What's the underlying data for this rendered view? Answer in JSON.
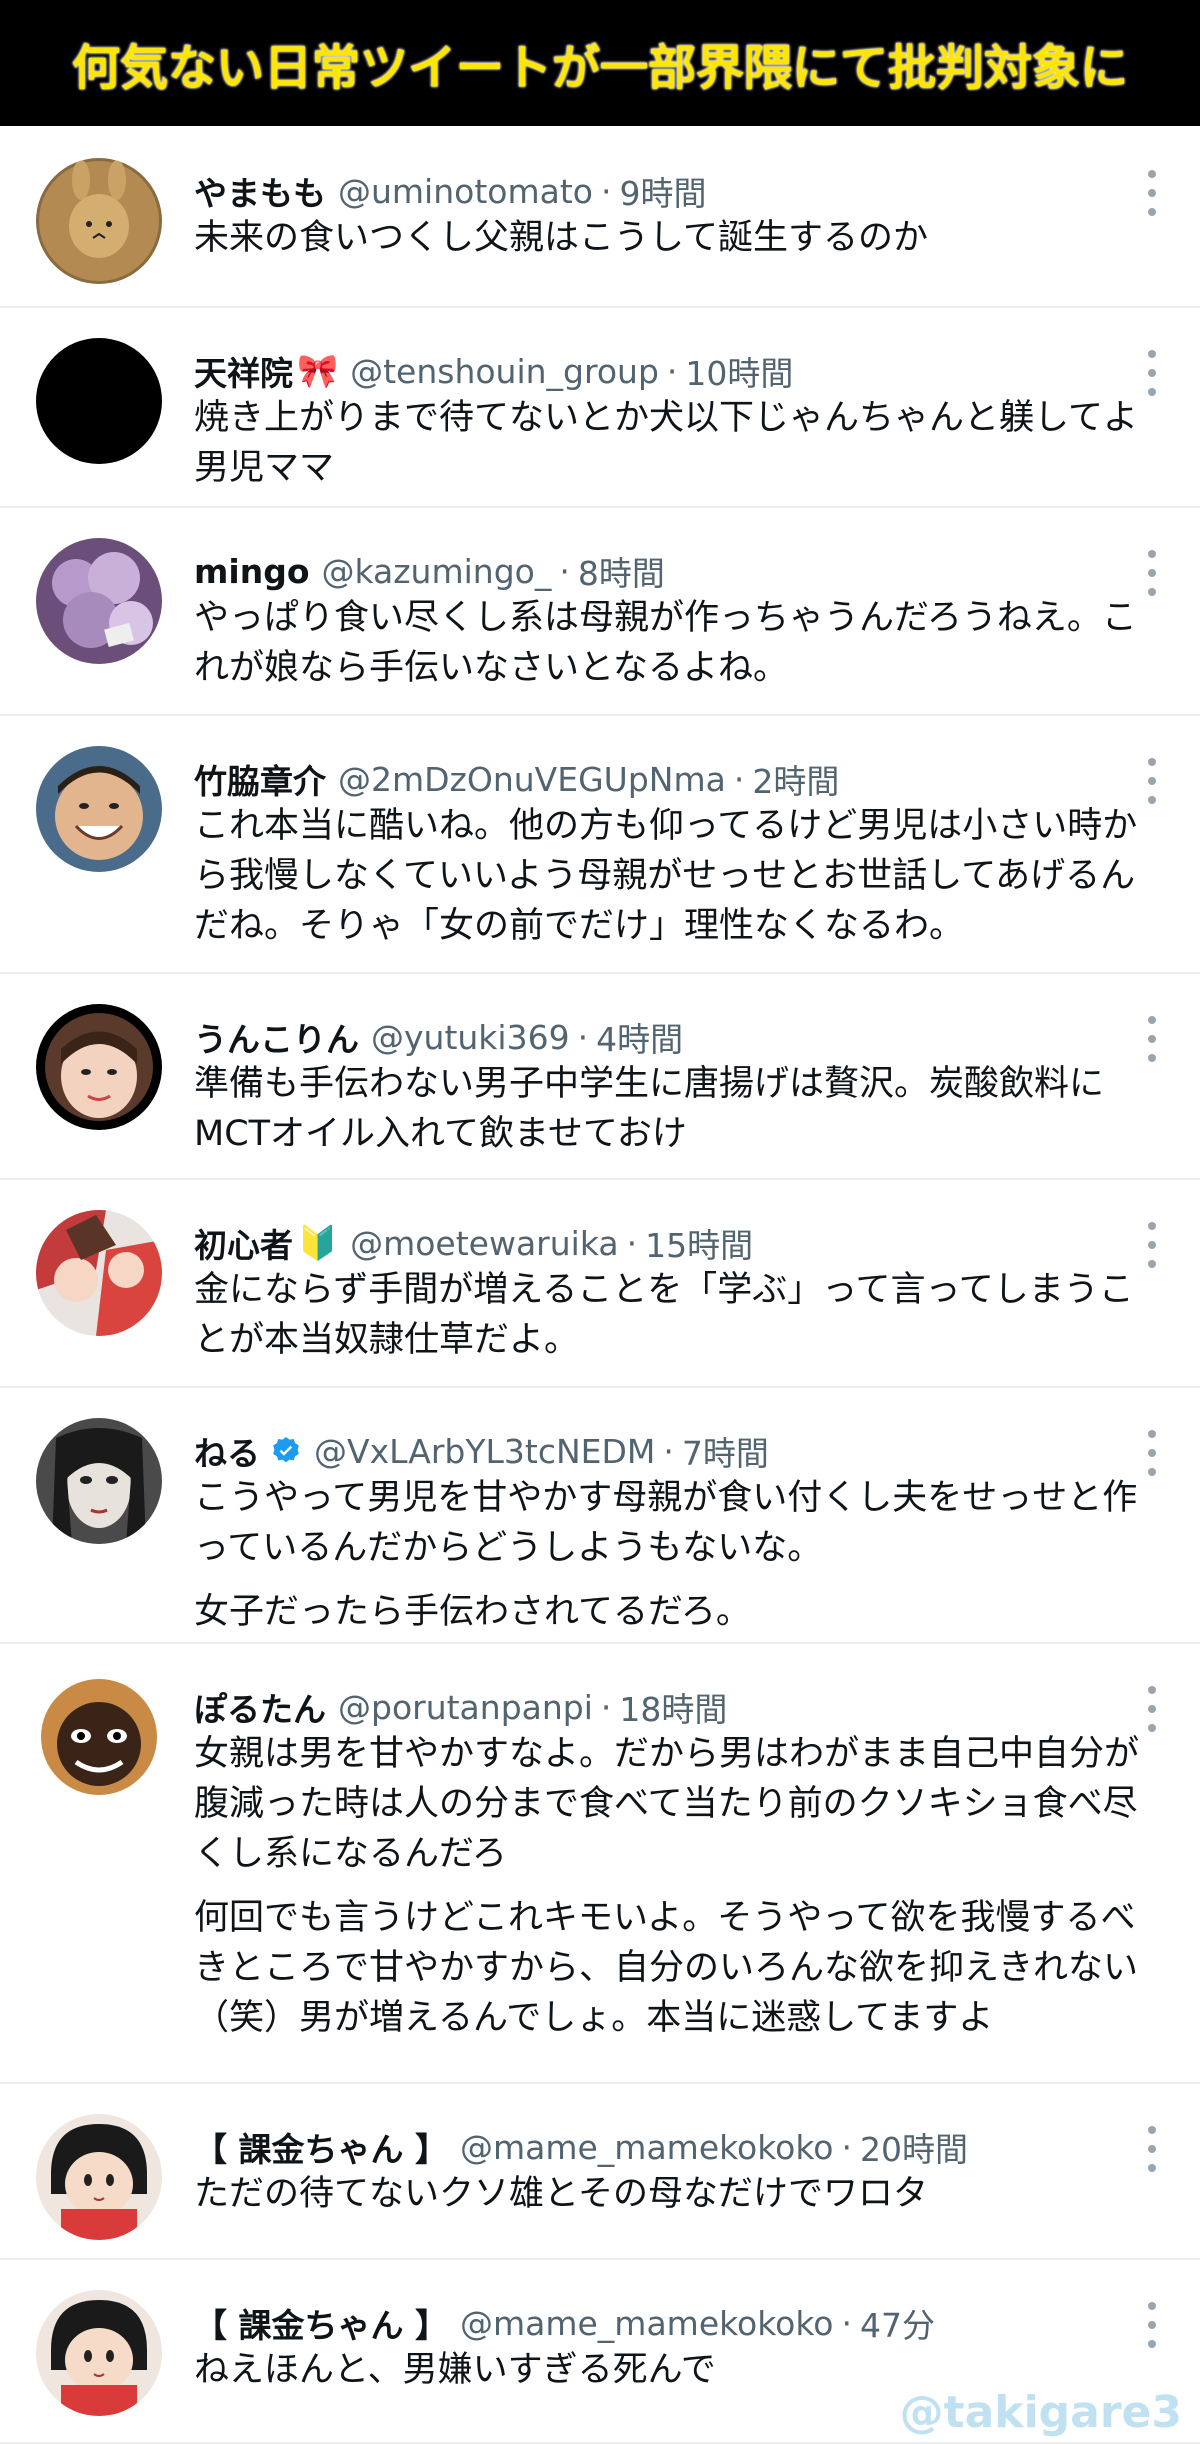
{
  "banner": {
    "title": "何気ない日常ツイートが一部界隈にて批判対象に"
  },
  "tweets": [
    {
      "name": "やまもも",
      "handle": "@uminotomato",
      "time": "9時間",
      "badge": "",
      "verified": false,
      "lines": [
        "未来の食いつくし父親はこうして誕生するのか"
      ]
    },
    {
      "name": "天祥院",
      "handle": "@tenshouin_group",
      "time": "10時間",
      "badge": "🎀",
      "verified": false,
      "lines": [
        "焼き上がりまで待てないとか犬以下じゃんちゃんと躾してよ男児ママ"
      ]
    },
    {
      "name": "mingo",
      "handle": "@kazumingo_",
      "time": "8時間",
      "badge": "",
      "verified": false,
      "lines": [
        "やっぱり食い尽くし系は母親が作っちゃうんだろうねえ。これが娘なら手伝いなさいとなるよね。"
      ]
    },
    {
      "name": "竹脇章介",
      "handle": "@2mDzOnuVEGUpNma",
      "time": "2時間",
      "badge": "",
      "verified": false,
      "lines": [
        "これ本当に酷いね。他の方も仰ってるけど男児は小さい時から我慢しなくていいよう母親がせっせとお世話してあげるんだね。そりゃ「女の前でだけ」理性なくなるわ。"
      ]
    },
    {
      "name": "うんこりん",
      "handle": "@yutuki369",
      "time": "4時間",
      "badge": "",
      "verified": false,
      "lines": [
        "準備も手伝わない男子中学生に唐揚げは贅沢。炭酸飲料にMCTオイル入れて飲ませておけ"
      ]
    },
    {
      "name": "初心者",
      "handle": "@moetewaruika",
      "time": "15時間",
      "badge": "🔰",
      "verified": false,
      "lines": [
        "金にならず手間が増えることを「学ぶ」って言ってしまうことが本当奴隷仕草だよ。"
      ]
    },
    {
      "name": "ねる",
      "handle": "@VxLArbYL3tcNEDM",
      "time": "7時間",
      "badge": "",
      "verified": true,
      "lines": [
        "こうやって男児を甘やかす母親が食い付くし夫をせっせと作っているんだからどうしようもないな。",
        "女子だったら手伝わされてるだろ。"
      ]
    },
    {
      "name": "ぽるたん",
      "handle": "@porutanpanpi",
      "time": "18時間",
      "badge": "",
      "verified": false,
      "lines": [
        "女親は男を甘やかすなよ。だから男はわがまま自己中自分が腹減った時は人の分まで食べて当たり前のクソキショ食べ尽くし系になるんだろ",
        "何回でも言うけどこれキモいよ。そうやって欲を我慢するべきところで甘やかすから、自分のいろんな欲を抑えきれない（笑）男が増えるんでしょ。本当に迷惑してますよ"
      ]
    },
    {
      "name": "【 課金ちゃん 】",
      "handle": "@mame_mamekokoko",
      "time": "20時間",
      "badge": "",
      "verified": false,
      "lines": [
        "ただの待てないクソ雄とその母なだけでワロタ"
      ]
    },
    {
      "name": "【 課金ちゃん 】",
      "handle": "@mame_mamekokoko",
      "time": "47分",
      "badge": "",
      "verified": false,
      "lines": [
        "ねえほんと、男嫌いすぎる死んで"
      ]
    }
  ],
  "separator": "·",
  "watermark": "@takigare3",
  "colors": {
    "banner_bg": "#000000",
    "banner_text": "#ffe600",
    "verified": "#1d9bf0",
    "secondary_text": "#536471"
  }
}
